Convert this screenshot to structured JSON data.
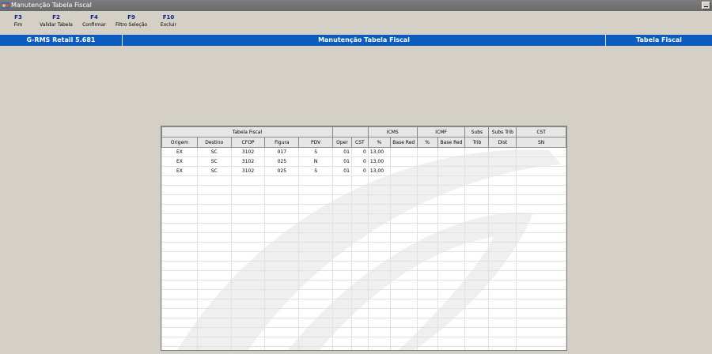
{
  "window": {
    "title": "Manutenção Tabela Fiscal"
  },
  "function_keys": [
    {
      "key": "F3",
      "label": "Fim"
    },
    {
      "key": "F2",
      "label": "Validar Tabela"
    },
    {
      "key": "F4",
      "label": "Confirmar"
    },
    {
      "key": "F9",
      "label": "Filtro Seleção"
    },
    {
      "key": "F10",
      "label": "Excluir"
    }
  ],
  "header_bar": {
    "app_version": "G-RMS Retail 5.681",
    "screen_title": "Manutenção Tabela Fiscal",
    "context": "Tabela Fiscal",
    "color": "#0b5cbc"
  },
  "grid": {
    "groups": [
      "Tabela Fiscal",
      "",
      "ICMS",
      "ICMF",
      "Subs",
      "Subs Trib",
      "CST"
    ],
    "columns": [
      "Origem",
      "Destino",
      "CFOP",
      "Figura",
      "PDV",
      "Oper",
      "CST",
      "%",
      "Base Red",
      "%",
      "Base Red",
      "Trib",
      "Dist",
      "SN"
    ],
    "rows": [
      [
        "EX",
        "SC",
        "3102",
        "017",
        "S",
        "01",
        "0",
        "13,00",
        "",
        "",
        "",
        "",
        "",
        ""
      ],
      [
        "EX",
        "SC",
        "3102",
        "025",
        "N",
        "01",
        "0",
        "13,00",
        "",
        "",
        "",
        "",
        "",
        ""
      ],
      [
        "EX",
        "SC",
        "3102",
        "025",
        "S",
        "01",
        "0",
        "13,00",
        "",
        "",
        "",
        "",
        "",
        ""
      ]
    ]
  }
}
